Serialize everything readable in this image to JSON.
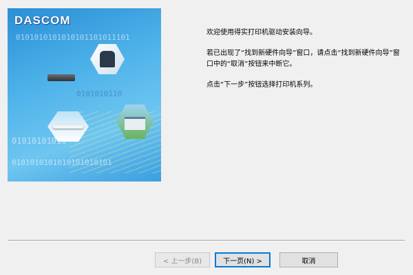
{
  "banner": {
    "logo_text": "DASCOM",
    "binary_rows": [
      "0101010101010101101011101",
      "0101010110",
      "01010101010",
      "0101010101010101010101"
    ]
  },
  "intro": {
    "line1": "欢迎使用得实打印机驱动安装向导。",
    "line2": "若已出现了“找到新硬件向导”窗口，请点击“找到新硬件向导”窗口中的“取消”按钮来中断它。",
    "line3": "点击“下一步”按钮选择打印机系列。"
  },
  "buttons": {
    "back": "< 上一步(B)",
    "next": "下一页(N) >",
    "cancel": "取消"
  }
}
